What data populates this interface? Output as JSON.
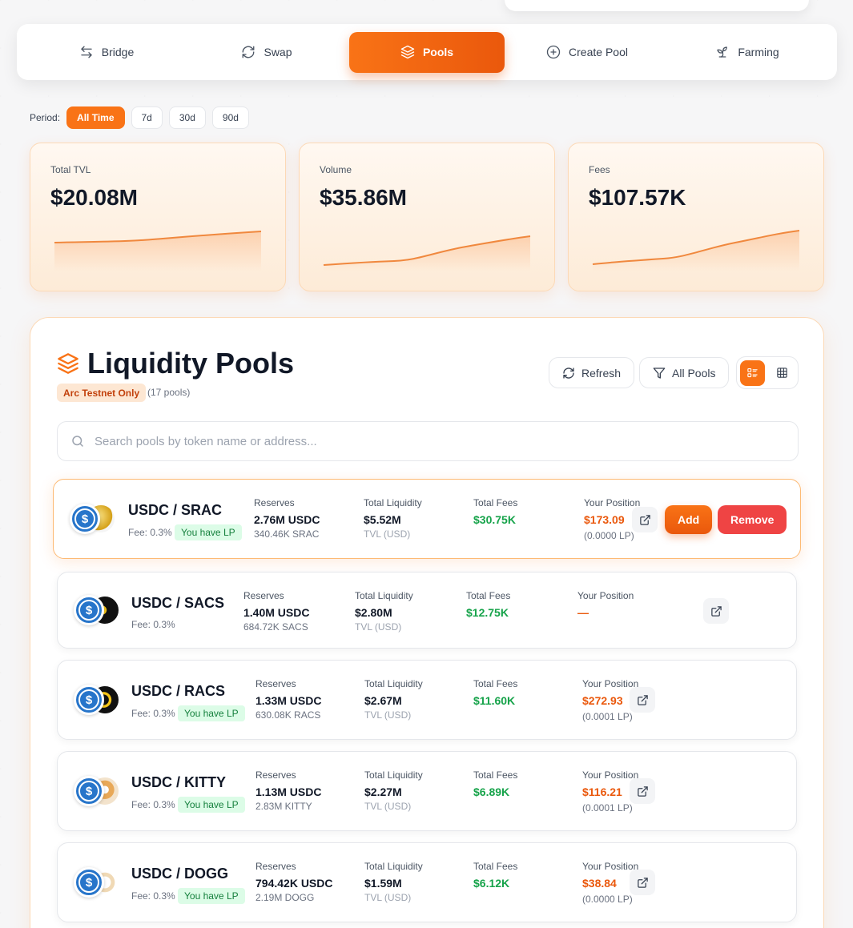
{
  "nav": {
    "items": [
      {
        "label": "Bridge",
        "icon": "arrows-left-right-icon"
      },
      {
        "label": "Swap",
        "icon": "refresh-icon"
      },
      {
        "label": "Pools",
        "icon": "layers-icon",
        "active": true
      },
      {
        "label": "Create Pool",
        "icon": "plus-circle-icon"
      },
      {
        "label": "Farming",
        "icon": "sprout-icon"
      }
    ]
  },
  "period": {
    "label": "Period:",
    "options": [
      "All Time",
      "7d",
      "30d",
      "90d"
    ],
    "selected": "All Time"
  },
  "stats": [
    {
      "label": "Total TVL",
      "value": "$20.08M"
    },
    {
      "label": "Volume",
      "value": "$35.86M"
    },
    {
      "label": "Fees",
      "value": "$107.57K"
    }
  ],
  "pools": {
    "title": "Liquidity Pools",
    "badge": "Arc Testnet Only",
    "count": "(17 pools)",
    "refresh_label": "Refresh",
    "filter_label": "All Pools",
    "search_placeholder": "Search pools by token name or address...",
    "labels": {
      "reserves": "Reserves",
      "total_liquidity": "Total Liquidity",
      "total_fees": "Total Fees",
      "your_position": "Your Position",
      "tvl_usd": "TVL (USD)",
      "you_have_lp": "You have LP",
      "add": "Add",
      "remove": "Remove"
    },
    "rows": [
      {
        "pair": "USDC / SRAC",
        "fee": "Fee: 0.3%",
        "reserve_main": "2.76M USDC",
        "reserve_sub": "340.46K SRAC",
        "liquidity": "$5.52M",
        "fees": "$30.75K",
        "position": "$173.09",
        "position_lp": "(0.0000 LP)"
      },
      {
        "pair": "USDC / SACS",
        "fee": "Fee: 0.3%",
        "reserve_main": "1.40M USDC",
        "reserve_sub": "684.72K SACS",
        "liquidity": "$2.80M",
        "fees": "$12.75K",
        "position": "—",
        "position_lp": ""
      },
      {
        "pair": "USDC / RACS",
        "fee": "Fee: 0.3%",
        "reserve_main": "1.33M USDC",
        "reserve_sub": "630.08K RACS",
        "liquidity": "$2.67M",
        "fees": "$11.60K",
        "position": "$272.93",
        "position_lp": "(0.0001 LP)"
      },
      {
        "pair": "USDC / KITTY",
        "fee": "Fee: 0.3%",
        "reserve_main": "1.13M USDC",
        "reserve_sub": "2.83M KITTY",
        "liquidity": "$2.27M",
        "fees": "$6.89K",
        "position": "$116.21",
        "position_lp": "(0.0001 LP)"
      },
      {
        "pair": "USDC / DOGG",
        "fee": "Fee: 0.3%",
        "reserve_main": "794.42K USDC",
        "reserve_sub": "2.19M DOGG",
        "liquidity": "$1.59M",
        "fees": "$6.12K",
        "position": "$38.84",
        "position_lp": "(0.0000 LP)"
      }
    ]
  },
  "colors": {
    "accent": "#f97316",
    "positive": "#16a34a",
    "danger": "#ef4444",
    "usdc": "#2775ca"
  }
}
